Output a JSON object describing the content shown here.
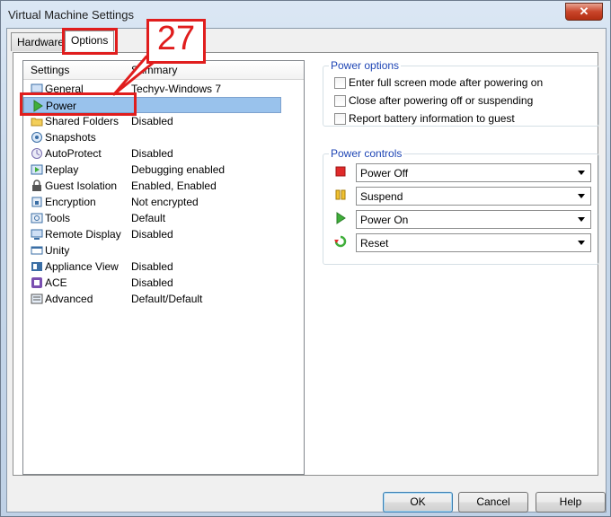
{
  "window": {
    "title": "Virtual Machine Settings",
    "close_label": "✕"
  },
  "tabs": [
    {
      "label": "Hardware"
    },
    {
      "label": "Options"
    }
  ],
  "tree": {
    "col_settings": "Settings",
    "col_summary": "Summary",
    "rows": [
      {
        "name": "General",
        "summary": "Techyv-Windows 7",
        "icon": "general-icon"
      },
      {
        "name": "Power",
        "summary": "",
        "icon": "power-play-icon"
      },
      {
        "name": "Shared Folders",
        "summary": "Disabled",
        "icon": "folder-icon"
      },
      {
        "name": "Snapshots",
        "summary": "",
        "icon": "snapshots-icon"
      },
      {
        "name": "AutoProtect",
        "summary": "Disabled",
        "icon": "autoprotect-icon"
      },
      {
        "name": "Replay",
        "summary": "Debugging enabled",
        "icon": "replay-icon"
      },
      {
        "name": "Guest Isolation",
        "summary": "Enabled, Enabled",
        "icon": "lock-icon"
      },
      {
        "name": "Encryption",
        "summary": "Not encrypted",
        "icon": "encryption-icon"
      },
      {
        "name": "Tools",
        "summary": "Default",
        "icon": "tools-icon"
      },
      {
        "name": "Remote Display",
        "summary": "Disabled",
        "icon": "remote-display-icon"
      },
      {
        "name": "Unity",
        "summary": "",
        "icon": "unity-icon"
      },
      {
        "name": "Appliance View",
        "summary": "Disabled",
        "icon": "appliance-icon"
      },
      {
        "name": "ACE",
        "summary": "Disabled",
        "icon": "ace-icon"
      },
      {
        "name": "Advanced",
        "summary": "Default/Default",
        "icon": "advanced-icon"
      }
    ]
  },
  "power_options": {
    "title": "Power options",
    "items": [
      {
        "label": "Enter full screen mode after powering on",
        "checked": false
      },
      {
        "label": "Close after powering off or suspending",
        "checked": false
      },
      {
        "label": "Report battery information to guest",
        "checked": false
      }
    ]
  },
  "power_controls": {
    "title": "Power controls",
    "items": [
      {
        "value": "Power Off",
        "icon": "stop-icon"
      },
      {
        "value": "Suspend",
        "icon": "pause-icon"
      },
      {
        "value": "Power On",
        "icon": "play-icon"
      },
      {
        "value": "Reset",
        "icon": "reset-icon"
      }
    ]
  },
  "buttons": {
    "ok": "OK",
    "cancel": "Cancel",
    "help": "Help"
  },
  "callout": {
    "number": "27"
  },
  "colors": {
    "accent": "#e01d1d",
    "group_title": "#1f46b5",
    "selection": "#99c2ec"
  }
}
